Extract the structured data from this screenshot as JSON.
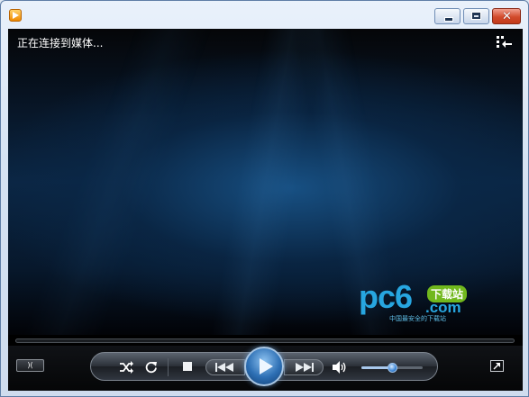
{
  "window": {
    "min_icon": "minimize-icon",
    "max_icon": "maximize-icon",
    "close_icon": "close-icon",
    "close_glyph": "✕"
  },
  "player": {
    "status_text": "正在连接到媒体...",
    "switch_view_icon": "switch-to-library-icon",
    "watermark": {
      "main": "pc6",
      "badge": "下载站",
      "suffix": ".com",
      "tagline": "中国最安全的下载站"
    },
    "seek_progress": 0
  },
  "controls": {
    "view_button_label": ")(",
    "shuffle_icon": "shuffle-icon",
    "repeat_icon": "repeat-icon",
    "stop_icon": "stop-icon",
    "previous_icon": "previous-icon",
    "play_icon": "play-icon",
    "next_icon": "next-icon",
    "mute_icon": "speaker-icon",
    "volume_level": 0.5,
    "fullscreen_icon": "fullscreen-icon"
  },
  "colors": {
    "accent": "#2d6fb4",
    "watermark_blue": "#27a6e0",
    "watermark_green": "#71b81d"
  }
}
